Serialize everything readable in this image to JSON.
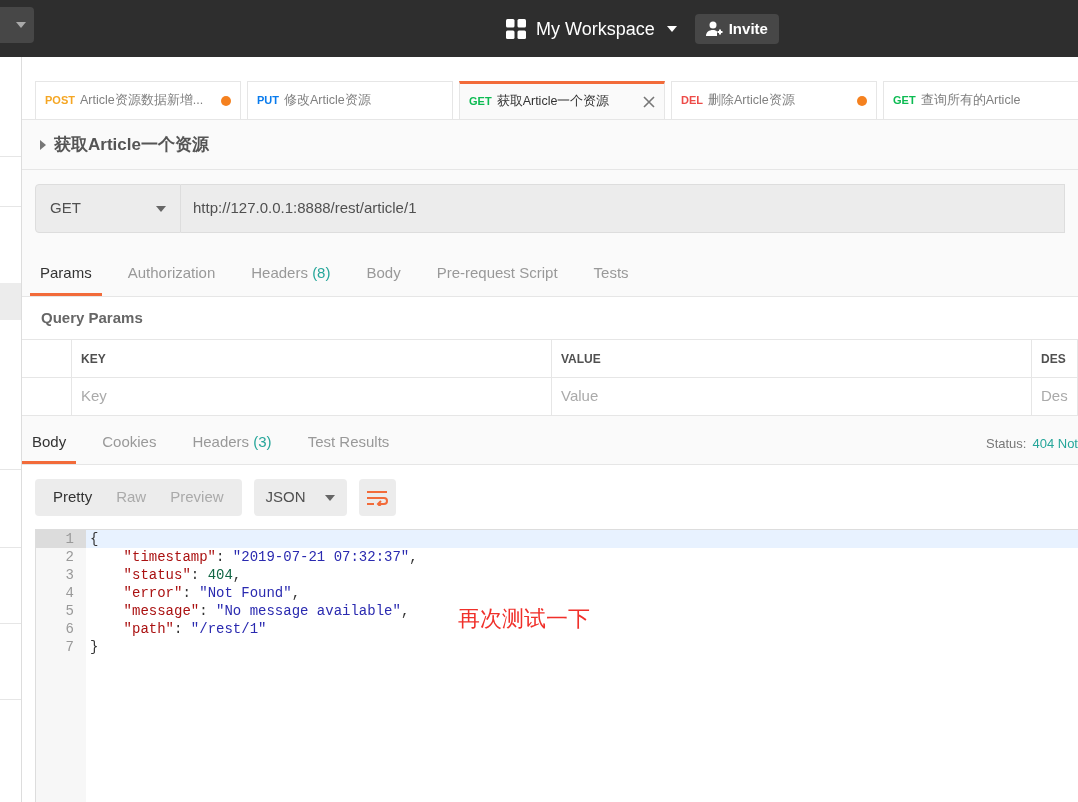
{
  "top_bar": {
    "workspace": "My Workspace",
    "invite": "Invite"
  },
  "tabs": [
    {
      "method": "POST",
      "color": "#f5a623",
      "name": "Article资源数据新增...",
      "selected": false,
      "unsaved": true
    },
    {
      "method": "PUT",
      "color": "#097bed",
      "name": "修改Article资源",
      "selected": false,
      "unsaved": false
    },
    {
      "method": "GET",
      "color": "#0cbb52",
      "name": "获取Article一个资源",
      "selected": true,
      "unsaved": false
    },
    {
      "method": "DEL",
      "color": "#ed4b48",
      "name": "删除Article资源",
      "selected": false,
      "unsaved": true
    },
    {
      "method": "GET",
      "color": "#0cbb52",
      "name": "查询所有的Article",
      "selected": false,
      "unsaved": false
    }
  ],
  "request": {
    "title": "获取Article一个资源",
    "method": "GET",
    "url": "http://127.0.0.1:8888/rest/article/1"
  },
  "request_tabs": [
    {
      "label": "Params",
      "selected": true
    },
    {
      "label": "Authorization",
      "selected": false
    },
    {
      "label": "Headers",
      "count": "(8)",
      "selected": false
    },
    {
      "label": "Body",
      "selected": false
    },
    {
      "label": "Pre-request Script",
      "selected": false
    },
    {
      "label": "Tests",
      "selected": false
    }
  ],
  "query_params": {
    "title": "Query Params",
    "columns": [
      "KEY",
      "VALUE",
      "DES"
    ],
    "placeholders": [
      "Key",
      "Value",
      "Des"
    ]
  },
  "response_tabs": [
    {
      "label": "Body",
      "selected": true
    },
    {
      "label": "Cookies",
      "selected": false
    },
    {
      "label": "Headers",
      "count": "(3)",
      "selected": false
    },
    {
      "label": "Test Results",
      "selected": false
    }
  ],
  "status": {
    "label": "Status:",
    "value": "404 Not"
  },
  "view_modes": [
    {
      "label": "Pretty",
      "selected": true
    },
    {
      "label": "Raw",
      "selected": false
    },
    {
      "label": "Preview",
      "selected": false
    }
  ],
  "format": "JSON",
  "code_lines": [
    {
      "number": "1",
      "highlighted": true,
      "segments": [
        {
          "text": "{",
          "kind": "punct"
        }
      ]
    },
    {
      "number": "2",
      "highlighted": false,
      "segments": [
        {
          "text": "    \"timestamp\"",
          "kind": "key"
        },
        {
          "text": ": ",
          "kind": "punct"
        },
        {
          "text": "\"2019-07-21 07:32:37\"",
          "kind": "string"
        },
        {
          "text": ",",
          "kind": "punct"
        }
      ]
    },
    {
      "number": "3",
      "highlighted": false,
      "segments": [
        {
          "text": "    \"status\"",
          "kind": "key"
        },
        {
          "text": ": ",
          "kind": "punct"
        },
        {
          "text": "404",
          "kind": "number"
        },
        {
          "text": ",",
          "kind": "punct"
        }
      ]
    },
    {
      "number": "4",
      "highlighted": false,
      "segments": [
        {
          "text": "    \"error\"",
          "kind": "key"
        },
        {
          "text": ": ",
          "kind": "punct"
        },
        {
          "text": "\"Not Found\"",
          "kind": "string"
        },
        {
          "text": ",",
          "kind": "punct"
        }
      ]
    },
    {
      "number": "5",
      "highlighted": false,
      "segments": [
        {
          "text": "    \"message\"",
          "kind": "key"
        },
        {
          "text": ": ",
          "kind": "punct"
        },
        {
          "text": "\"No message available\"",
          "kind": "string"
        },
        {
          "text": ",",
          "kind": "punct"
        }
      ]
    },
    {
      "number": "6",
      "highlighted": false,
      "segments": [
        {
          "text": "    \"path\"",
          "kind": "key"
        },
        {
          "text": ": ",
          "kind": "punct"
        },
        {
          "text": "\"/rest/1\"",
          "kind": "string"
        }
      ]
    },
    {
      "number": "7",
      "highlighted": false,
      "segments": [
        {
          "text": "}",
          "kind": "punct"
        }
      ]
    }
  ],
  "annotation": "再次测试一下"
}
